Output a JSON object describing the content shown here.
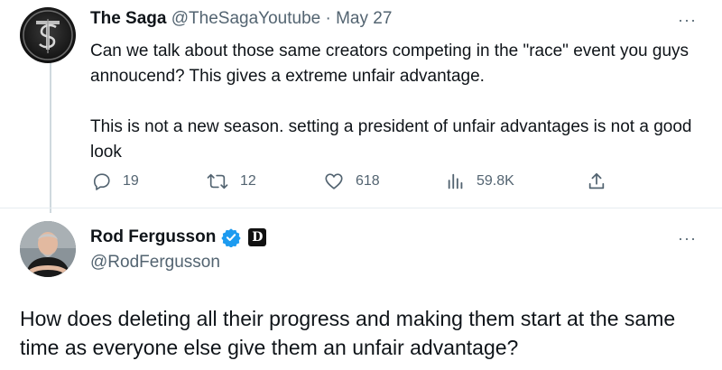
{
  "tweet1": {
    "display_name": "The Saga",
    "handle": "@TheSagaYoutube",
    "separator": "·",
    "date": "May 27",
    "paragraphs": [
      "Can we talk about those same creators competing in the \"race\" event you guys annoucend? This gives a extreme unfair advantage.",
      "This is not a new season. setting a president of unfair advantages is not a good look"
    ],
    "actions": {
      "replies": "19",
      "retweets": "12",
      "likes": "618",
      "views": "59.8K"
    },
    "more": "···"
  },
  "tweet2": {
    "display_name": "Rod Fergusson",
    "handle": "@RodFergusson",
    "affiliate_badge": "D",
    "more": "···",
    "body": "How does deleting all their progress and making them start at the same time as everyone else give them an unfair advantage?"
  },
  "colors": {
    "text": "#0f1419",
    "muted": "#536471",
    "verified": "#1d9bf0",
    "divider": "#e6ecf0"
  }
}
